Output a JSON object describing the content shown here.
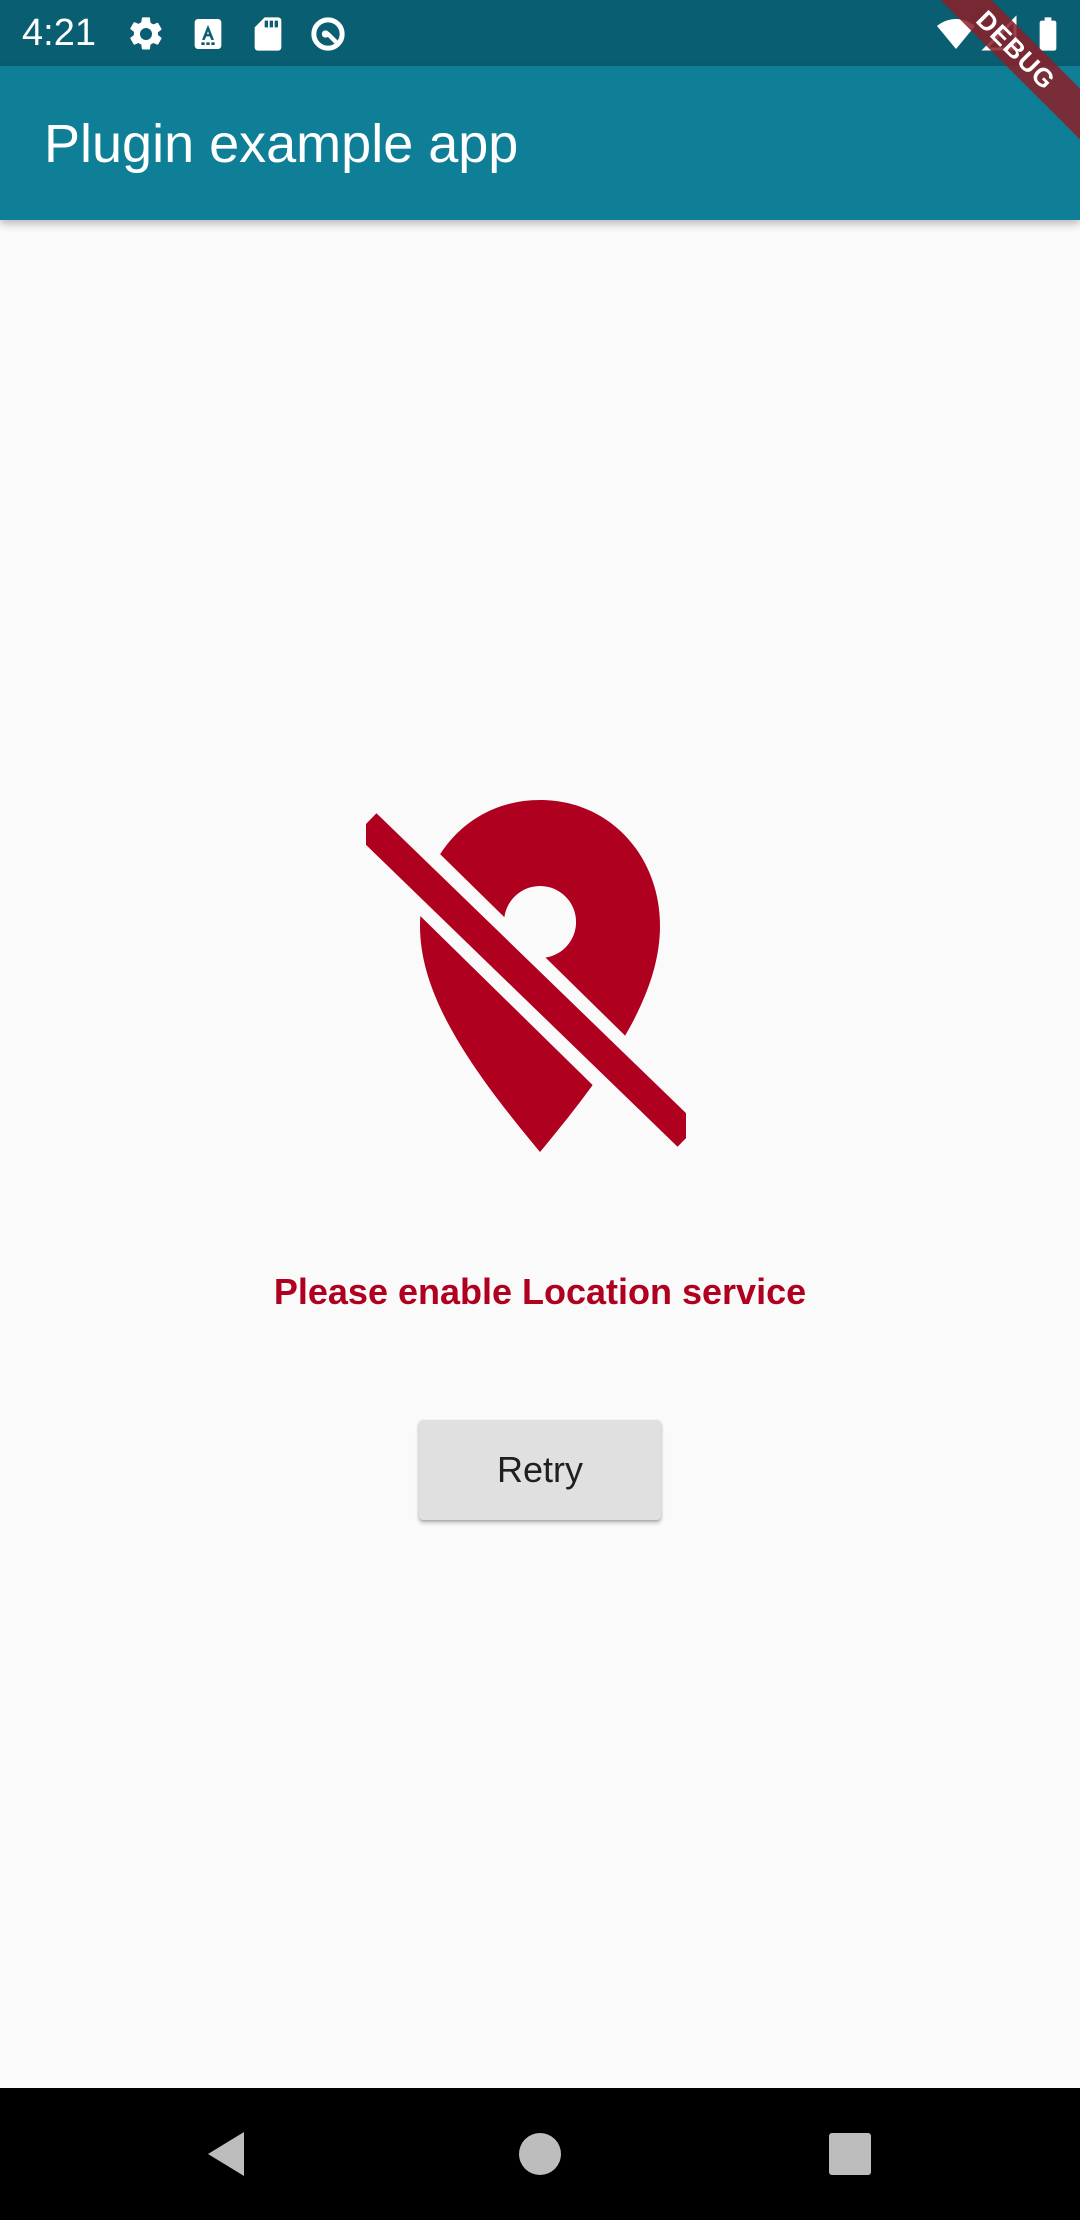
{
  "status_bar": {
    "time": "4:21",
    "left_icons": [
      "gear-icon",
      "text-a-icon",
      "sd-card-icon",
      "vpn-key-circle-icon"
    ],
    "right_icons": [
      "wifi-icon",
      "signal-icon",
      "battery-icon"
    ]
  },
  "app_bar": {
    "title": "Plugin example app"
  },
  "debug_banner": {
    "label": "DEBUG"
  },
  "main": {
    "icon": "location-off-icon",
    "message": "Please enable Location service",
    "retry_label": "Retry"
  },
  "nav_bar": {
    "buttons": [
      "back-icon",
      "home-icon",
      "recents-icon"
    ]
  },
  "colors": {
    "status_bar": "#0a5e72",
    "app_bar": "#0f7f98",
    "accent_red": "#b00020",
    "background": "#fafafa",
    "button_bg": "#e0e0e0"
  }
}
